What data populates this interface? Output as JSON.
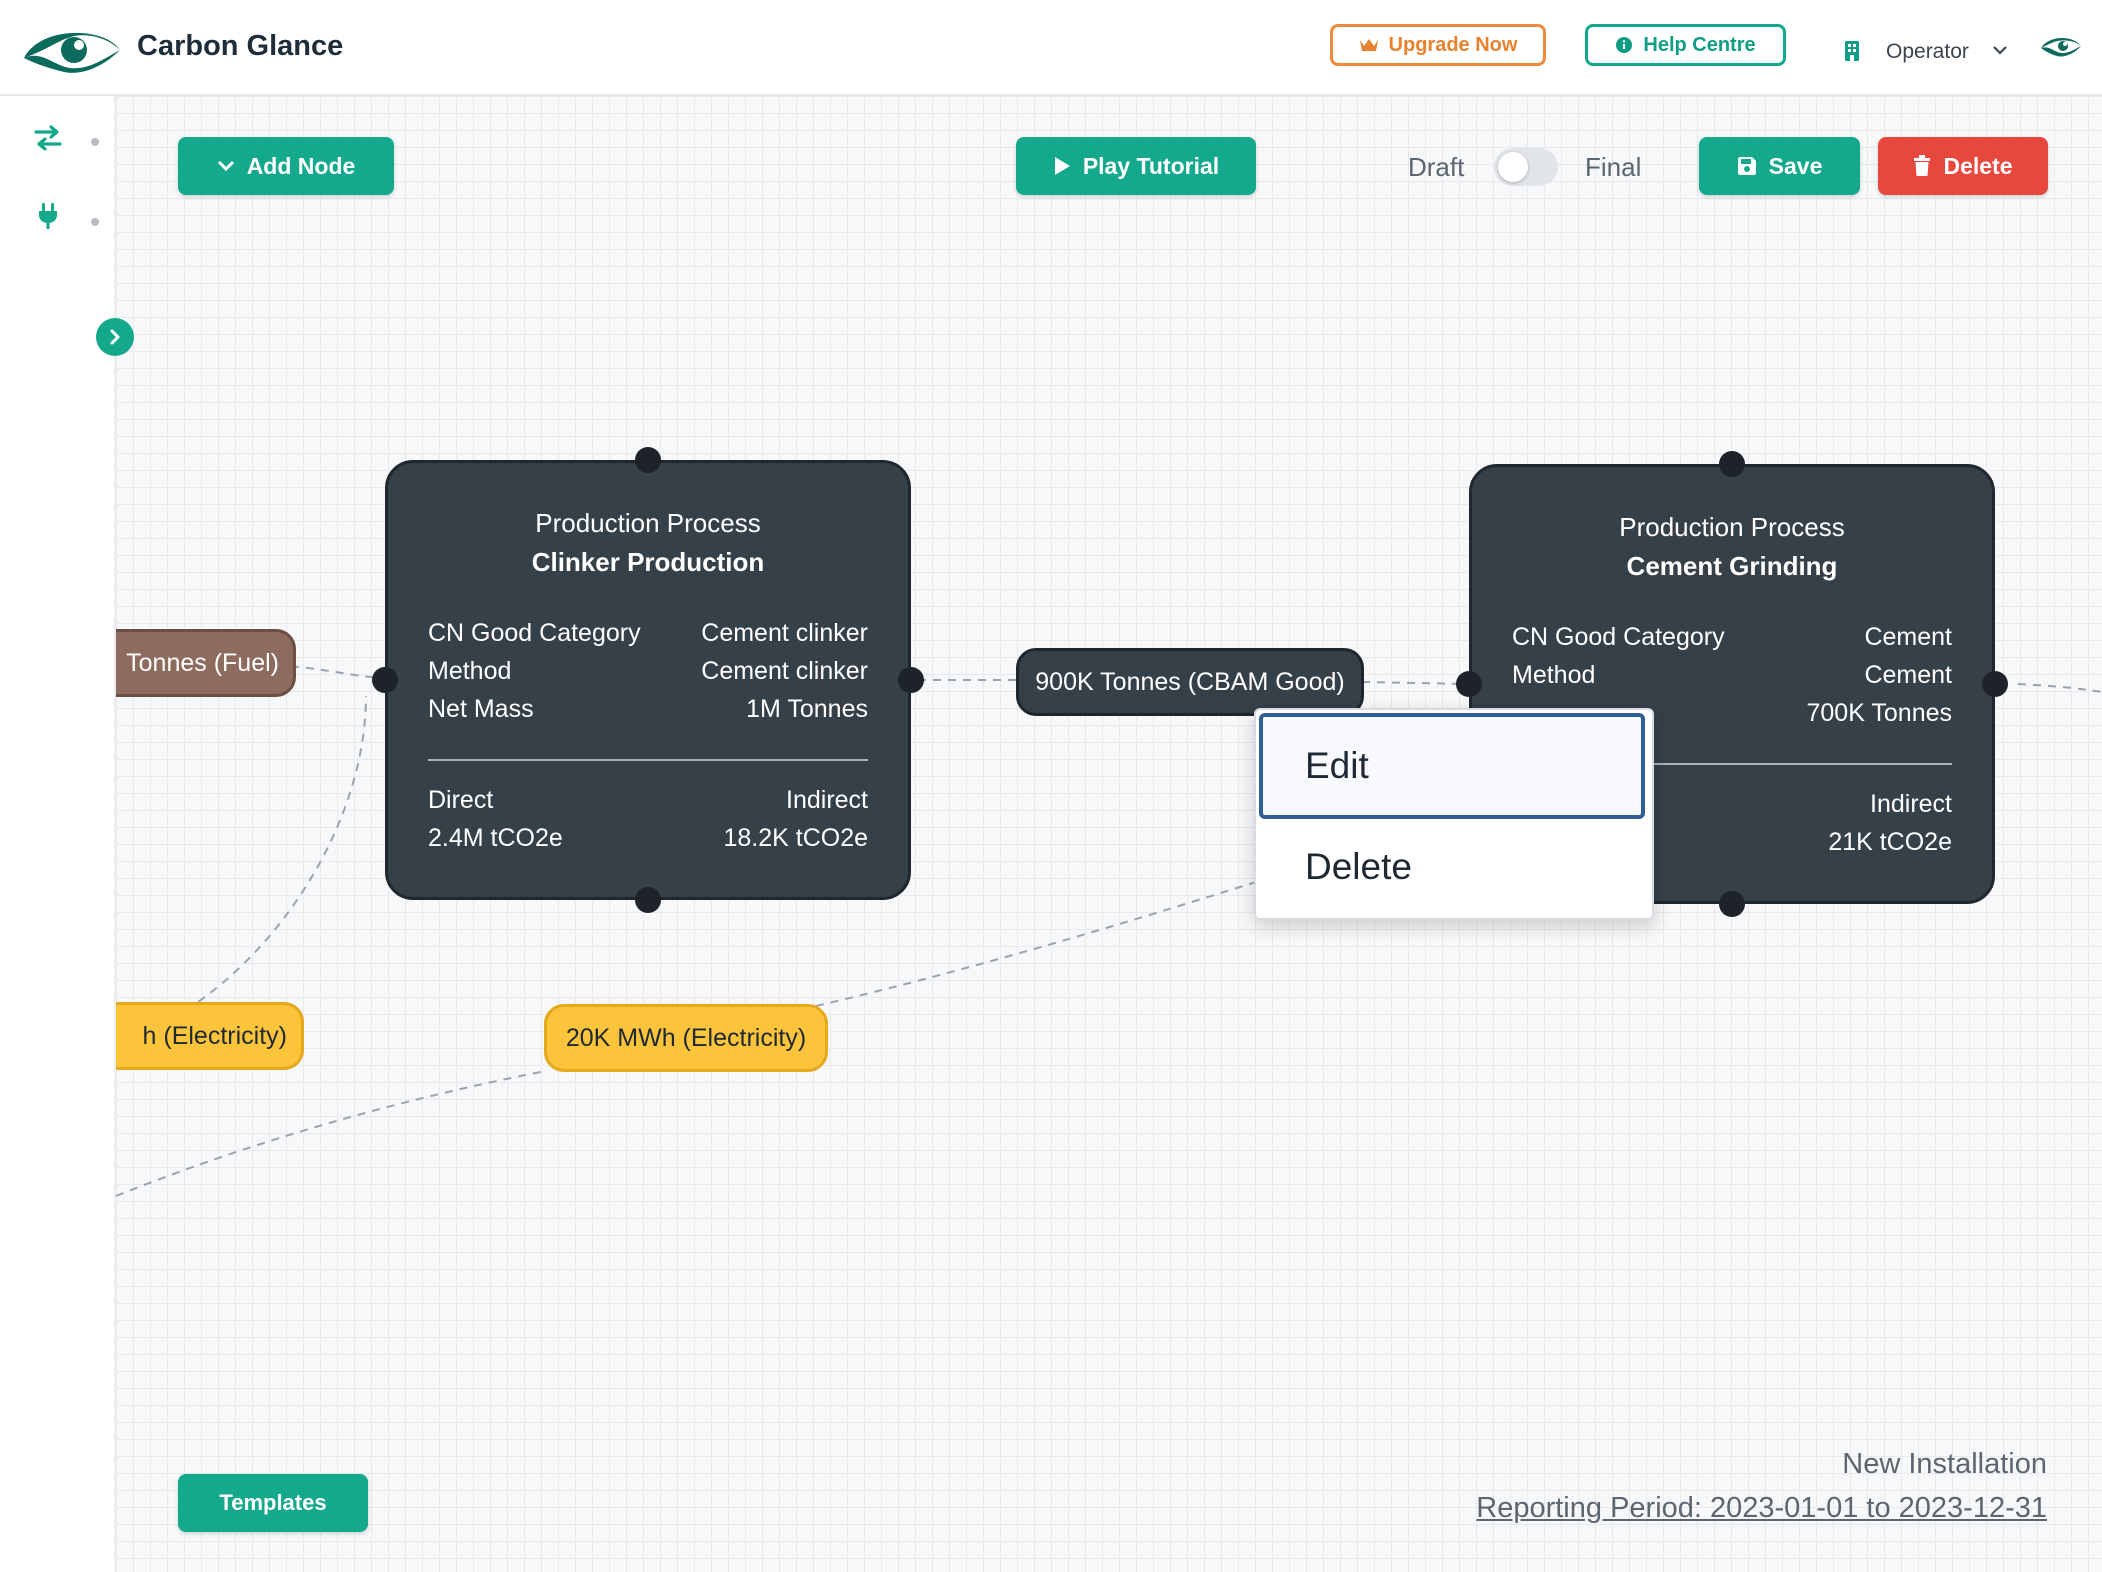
{
  "header": {
    "app_title": "Carbon Glance",
    "upgrade_label": "Upgrade Now",
    "help_label": "Help Centre",
    "operator_label": "Operator"
  },
  "toolbar": {
    "add_node_label": "Add Node",
    "play_tutorial_label": "Play Tutorial",
    "draft_label": "Draft",
    "final_label": "Final",
    "save_label": "Save",
    "delete_label": "Delete",
    "templates_label": "Templates"
  },
  "nodes": [
    {
      "type": "Production Process",
      "name": "Clinker Production",
      "rows": [
        {
          "label": "CN Good Category",
          "value": "Cement clinker"
        },
        {
          "label": "Method",
          "value": "Cement clinker"
        },
        {
          "label": "Net Mass",
          "value": "1M Tonnes"
        }
      ],
      "direct_label": "Direct",
      "direct_value": "2.4M tCO2e",
      "indirect_label": "Indirect",
      "indirect_value": "18.2K tCO2e"
    },
    {
      "type": "Production Process",
      "name": "Cement Grinding",
      "rows": [
        {
          "label": "CN Good Category",
          "value": "Cement"
        },
        {
          "label": "Method",
          "value": "Cement"
        },
        {
          "label": "",
          "value": "700K Tonnes"
        }
      ],
      "indirect_label": "Indirect",
      "indirect_value": "21K tCO2e"
    }
  ],
  "flows": {
    "fuel": "Tonnes (Fuel)",
    "electricity_left": "h (Electricity)",
    "electricity_mid": "20K MWh (Electricity)",
    "cbam_good": "900K Tonnes (CBAM Good)"
  },
  "context_menu": {
    "edit_label": "Edit",
    "delete_label": "Delete"
  },
  "footer": {
    "installation_name": "New Installation",
    "reporting_period": "Reporting Period: 2023-01-01 to 2023-12-31"
  },
  "toggle_state": "Draft",
  "colors": {
    "brand_green": "#14a88c",
    "delete_red": "#e8473d",
    "upgrade_orange": "#ee8a3c",
    "node_dark": "#364049",
    "electricity_yellow": "#fcc43b",
    "fuel_brown": "#8d6b5e"
  },
  "icons": {
    "logo": "eye-logo-icon",
    "upgrade": "crown-icon",
    "help": "info-icon",
    "operator": "building-icon",
    "sidebar_top": "swap-arrows-icon",
    "sidebar_second": "plug-icon"
  }
}
